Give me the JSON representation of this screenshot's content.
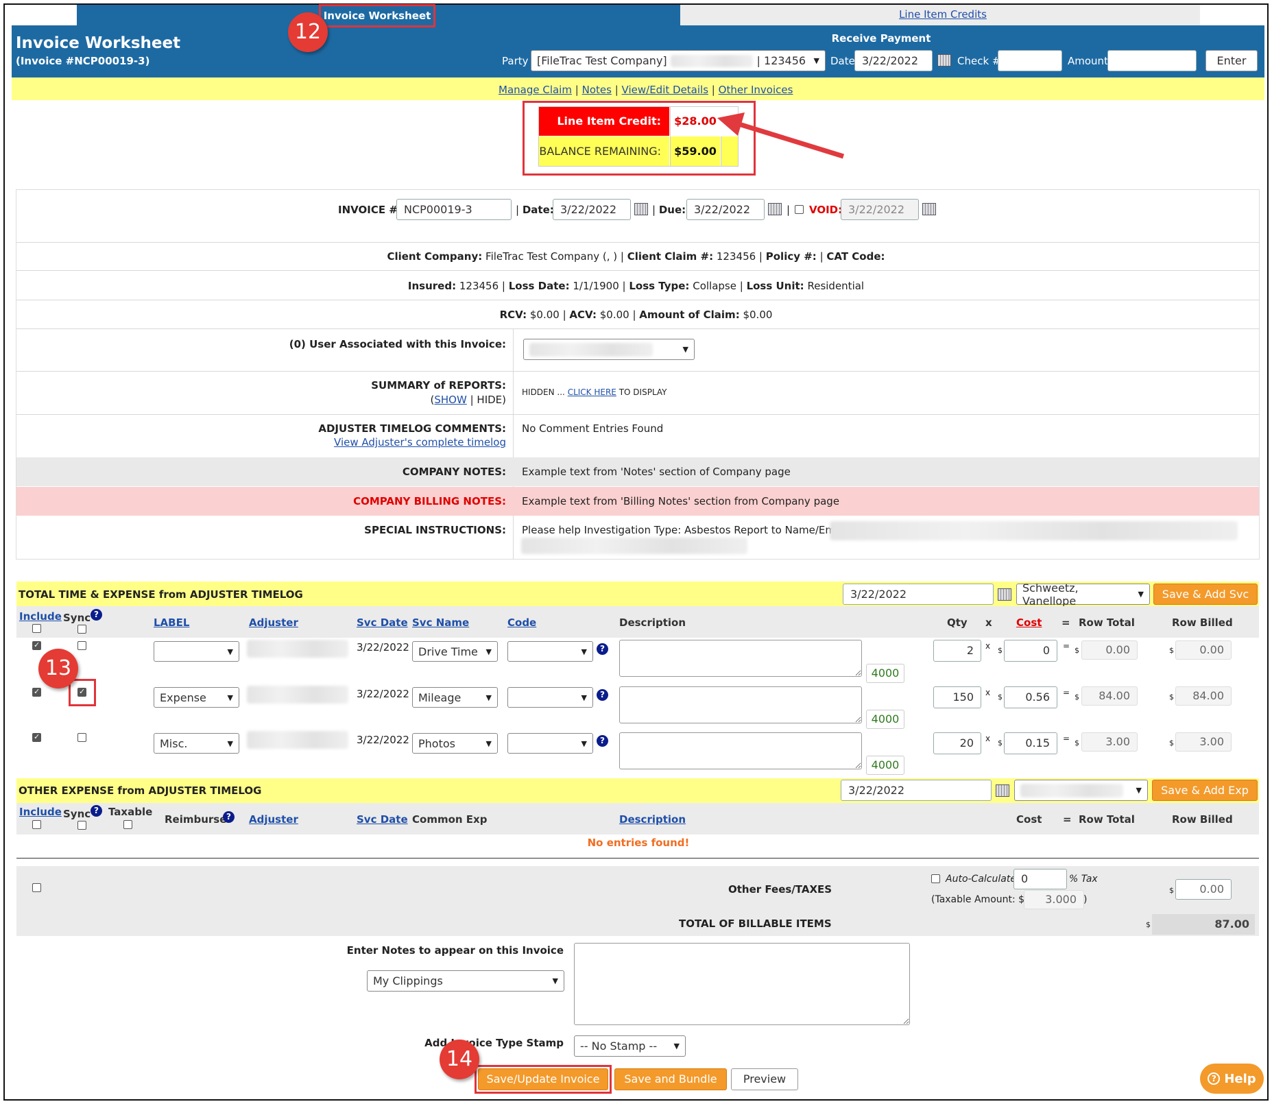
{
  "tabs": {
    "active": "Invoice Worksheet",
    "inactive": "Line Item Credits"
  },
  "header": {
    "title": "Invoice Worksheet",
    "subtitle": "(Invoice #NCP00019-3)",
    "receive_payment": "Receive Payment",
    "party_label": "Party",
    "party_value_left": "[FileTrac Test Company]",
    "party_value_right": "| 123456",
    "date_label": "Date",
    "date_value": "3/22/2022",
    "check_label": "Check #",
    "amount_label": "Amount",
    "enter_button": "Enter"
  },
  "nav_links": {
    "manage_claim": "Manage Claim",
    "notes": "Notes",
    "view_edit": "View/Edit Details",
    "other_invoices": "Other Invoices",
    "sep": "|"
  },
  "credit_box": {
    "credit_label": "Line Item Credit:",
    "credit_value": "$28.00",
    "balance_label": "BALANCE REMAINING:",
    "balance_value": "$59.00"
  },
  "invoice_info": {
    "invoice_label": "INVOICE #:",
    "invoice_value": "NCP00019-3",
    "date_label": "Date:",
    "date_value": "3/22/2022",
    "due_label": "Due:",
    "due_value": "3/22/2022",
    "void_label": "VOID:",
    "void_value": "3/22/2022",
    "client_company_label": "Client Company:",
    "client_company_value": "FileTrac Test Company (, )",
    "client_claim_label": "Client Claim #:",
    "client_claim_value": "123456",
    "policy_label": "Policy #:",
    "cat_code_label": "CAT Code:",
    "insured_label": "Insured:",
    "insured_value": "123456",
    "loss_date_label": "Loss Date:",
    "loss_date_value": "1/1/1900",
    "loss_type_label": "Loss Type:",
    "loss_type_value": "Collapse",
    "loss_unit_label": "Loss Unit:",
    "loss_unit_value": "Residential",
    "rcv_label": "RCV:",
    "rcv_value": "$0.00",
    "acv_label": "ACV:",
    "acv_value": "$0.00",
    "amount_claim_label": "Amount of Claim:",
    "amount_claim_value": "$0.00",
    "user_assoc_label": "(0) User Associated with this Invoice:",
    "summary_label": "SUMMARY of REPORTS:",
    "summary_show": "SHOW",
    "summary_hide": "| HIDE)",
    "summary_open": "(",
    "summary_hidden": "HIDDEN ...",
    "summary_click": "CLICK HERE",
    "summary_display": "TO DISPLAY",
    "timelog_label": "ADJUSTER TIMELOG COMMENTS:",
    "timelog_link": "View Adjuster's complete timelog",
    "timelog_value": "No Comment Entries Found",
    "company_notes_label": "COMPANY NOTES:",
    "company_notes_value": "Example text from 'Notes' section of Company page",
    "billing_notes_label": "COMPANY BILLING NOTES:",
    "billing_notes_value": "Example text from 'Billing Notes' section from Company page",
    "special_label": "SPECIAL INSTRUCTIONS:",
    "special_value": "Please help Investigation Type: Asbestos Report to Name/Email:"
  },
  "time_expense": {
    "title": "TOTAL TIME & EXPENSE from ADJUSTER TIMELOG",
    "date_value": "3/22/2022",
    "adjuster_select": "Schweetz, Vanellope",
    "add_button": "Save & Add Svc",
    "headers": {
      "include": "Include",
      "sync": "Sync",
      "label": "LABEL",
      "adjuster": "Adjuster",
      "svc_date": "Svc Date",
      "svc_name": "Svc Name",
      "code": "Code",
      "description": "Description",
      "qty": "Qty",
      "x": "x",
      "cost": "Cost",
      "eq": "=",
      "row_total": "Row Total",
      "row_billed": "Row Billed"
    },
    "rows": [
      {
        "label": "",
        "svc_date": "3/22/2022",
        "svc_name": "Drive Time",
        "gl": "4000",
        "qty": "2",
        "cost": "0",
        "row_total": "0.00",
        "row_billed": "0.00",
        "include": true,
        "sync": false
      },
      {
        "label": "Expense",
        "svc_date": "3/22/2022",
        "svc_name": "Mileage",
        "gl": "4000",
        "qty": "150",
        "cost": "0.56",
        "row_total": "84.00",
        "row_billed": "84.00",
        "include": true,
        "sync": true
      },
      {
        "label": "Misc.",
        "svc_date": "3/22/2022",
        "svc_name": "Photos",
        "gl": "4000",
        "qty": "20",
        "cost": "0.15",
        "row_total": "3.00",
        "row_billed": "3.00",
        "include": true,
        "sync": false
      }
    ],
    "x_sym": "x",
    "dollar": "$",
    "eq_sym": "="
  },
  "other_expense": {
    "title": "OTHER EXPENSE from ADJUSTER TIMELOG",
    "date_value": "3/22/2022",
    "add_button": "Save & Add Exp",
    "headers": {
      "include": "Include",
      "sync": "Sync",
      "taxable": "Taxable",
      "reimburse": "Reimburse",
      "adjuster": "Adjuster",
      "svc_date": "Svc Date",
      "common_exp": "Common Exp",
      "description": "Description",
      "cost": "Cost",
      "eq": "=",
      "row_total": "Row Total",
      "row_billed": "Row Billed"
    },
    "empty": "No entries found!"
  },
  "fees": {
    "label": "Other Fees/TAXES",
    "auto_calc": "Auto-Calculate",
    "tax_value": "0",
    "tax_label": "% Tax",
    "taxable_label": "(Taxable Amount: $",
    "taxable_value": "3.000",
    "taxable_close": ")",
    "fee_value": "0.00",
    "total_label": "TOTAL OF BILLABLE ITEMS",
    "total_value": "87.00",
    "dollar": "$"
  },
  "notes_section": {
    "label": "Enter Notes to appear on this Invoice",
    "clippings": "My Clippings",
    "stamp_label": "Add Invoice Type Stamp",
    "stamp_value": "-- No Stamp --"
  },
  "actions": {
    "save_update": "Save/Update Invoice",
    "save_bundle": "Save and Bundle",
    "preview": "Preview",
    "help": "Help"
  },
  "annotations": {
    "step12": "12",
    "step13": "13",
    "step14": "14"
  },
  "colors": {
    "header_blue": "#1d6aa3",
    "nav_yellow": "#ffff88",
    "credit_red": "#ff0000",
    "orange_button": "#f39a2b",
    "annotation_red": "#e43b34"
  }
}
